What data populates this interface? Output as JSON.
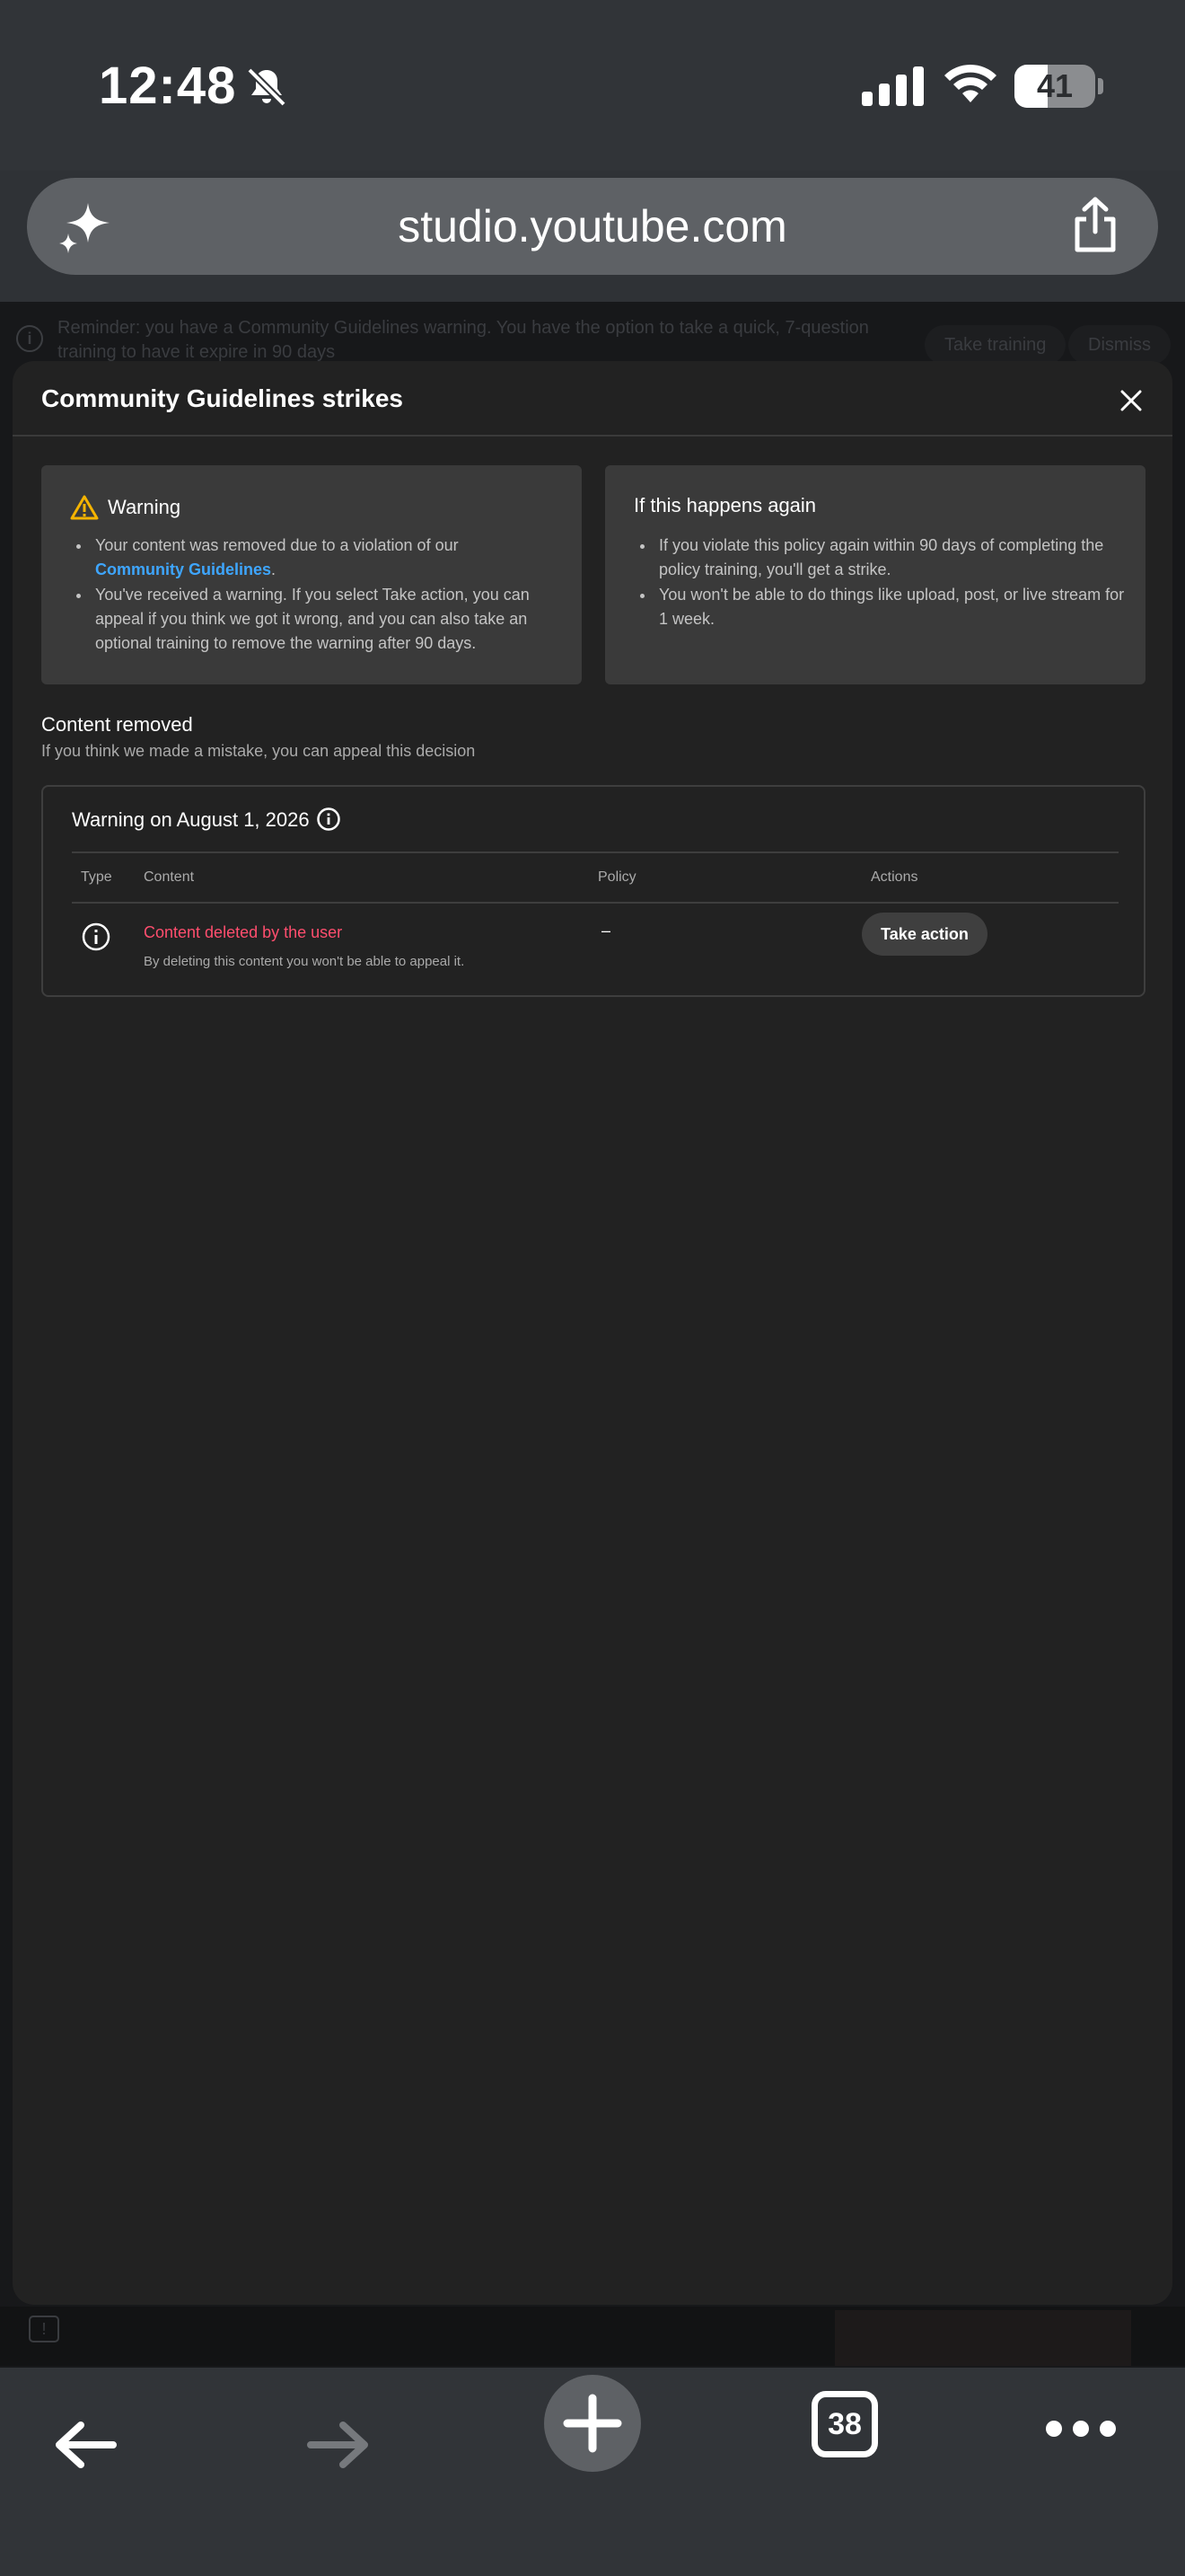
{
  "status_bar": {
    "time": "12:48",
    "battery": "41",
    "battery_level": 0.41
  },
  "browser": {
    "url": "studio.youtube.com",
    "tab_count": "38"
  },
  "background": {
    "banner_text": "Reminder: you have a Community Guidelines warning. You have the option to take a quick, 7-question training to have it expire in 90 days",
    "take_training": "Take training",
    "dismiss": "Dismiss"
  },
  "dialog": {
    "title": "Community Guidelines strikes",
    "warning_card": {
      "title": "Warning",
      "item1_text": "Your content was removed due to a violation of our",
      "item1_link": "Community Guidelines",
      "item1_end": ".",
      "item2": "You've received a warning. If you select Take action, you can appeal if you think we got it wrong, and you can also take an optional training to remove the warning after 90 days."
    },
    "again_card": {
      "title": "If this happens again",
      "item1": "If you violate this policy again within 90 days of completing the policy training, you'll get a strike.",
      "item2": "You won't be able to do things like upload, post, or live stream for 1 week."
    },
    "section": {
      "title": "Content removed",
      "subtitle": "If you think we made a mistake, you can appeal this decision"
    },
    "strike": {
      "heading": "Warning on August 1, 2026",
      "columns": {
        "type": "Type",
        "content": "Content",
        "policy": "Policy",
        "actions": "Actions"
      },
      "row": {
        "content": "Content deleted by the user",
        "note": "By deleting this content you won't be able to appeal it.",
        "policy": "–",
        "action": "Take action"
      }
    }
  },
  "colors": {
    "accent_link": "#3ea6ff",
    "deleted_text": "#ff4e6e",
    "warning_icon": "#f5b400"
  }
}
